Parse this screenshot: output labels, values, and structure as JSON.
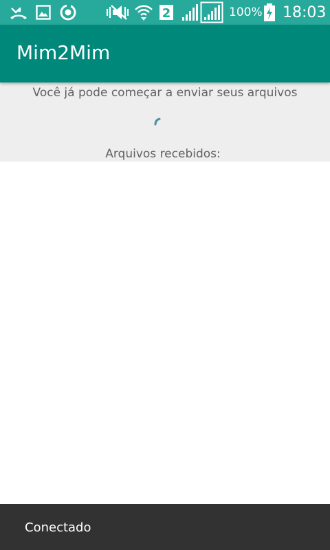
{
  "status_bar": {
    "battery_percent": "100%",
    "time": "18:03",
    "sim_slot": "2",
    "icons": [
      "missed-call-icon",
      "gallery-icon",
      "sync-icon",
      "vibrate-icon",
      "wifi-icon",
      "sim-2-icon",
      "signal-icon",
      "signal-icon",
      "battery-charging-icon"
    ],
    "colors": {
      "background": "#27a99b",
      "foreground": "#ffffff"
    }
  },
  "app_bar": {
    "title": "Mim2Mim",
    "color": "#00897b"
  },
  "main": {
    "info_message": "Você já pode começar a enviar seus arquivos",
    "received_label": "Arquivos recebidos:",
    "spinner_color": "#4f8fa0"
  },
  "snackbar": {
    "message": "Conectado"
  }
}
